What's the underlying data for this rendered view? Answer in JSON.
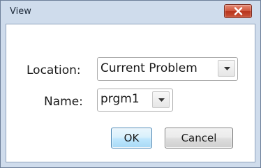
{
  "window": {
    "title": "View",
    "close_icon": "close-x-icon"
  },
  "form": {
    "location_label": "Location:",
    "location_value": "Current Problem",
    "name_label": "Name:",
    "name_value": "prgm1",
    "dropdown_icon": "chevron-down-icon"
  },
  "buttons": {
    "ok_label": "OK",
    "cancel_label": "Cancel"
  },
  "colors": {
    "frame": "#cfdcec",
    "close_button": "#c9553b",
    "ok_button_accent": "#bee6fd"
  }
}
